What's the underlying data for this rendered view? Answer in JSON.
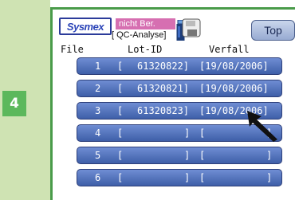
{
  "step": {
    "number": "4"
  },
  "header": {
    "logo": "Sysmex",
    "status": "nicht Ber.",
    "mode": "[ QC-Analyse]",
    "top_button": "Top"
  },
  "columns": {
    "file": "File",
    "lot": "Lot-ID",
    "expiry": "Verfall"
  },
  "rows": [
    {
      "file": "1",
      "lot_open": "[",
      "lot": "61320822]",
      "expiry": "[19/08/2006]"
    },
    {
      "file": "2",
      "lot_open": "[",
      "lot": "61320821]",
      "expiry": "[19/08/2006]"
    },
    {
      "file": "3",
      "lot_open": "[",
      "lot": "61320823]",
      "expiry": "[19/08/2006]"
    },
    {
      "file": "4",
      "lot_open": "[",
      "lot": "]",
      "expiry": "[",
      "expiry_close": "]"
    },
    {
      "file": "5",
      "lot_open": "[",
      "lot": "]",
      "expiry": "[",
      "expiry_close": "]"
    },
    {
      "file": "6",
      "lot_open": "[",
      "lot": "]",
      "expiry": "[",
      "expiry_close": "]"
    }
  ],
  "colors": {
    "side_panel": "#cfe3b3",
    "step_badge": "#5cb85c",
    "frame": "#4a9b4a",
    "status_label": "#d66fb1",
    "row_button": "#4f6fba"
  },
  "icons": {
    "bottle": "reagent-bottle-icon",
    "disk": "floppy-disk-icon",
    "cursor": "mouse-pointer-icon"
  }
}
